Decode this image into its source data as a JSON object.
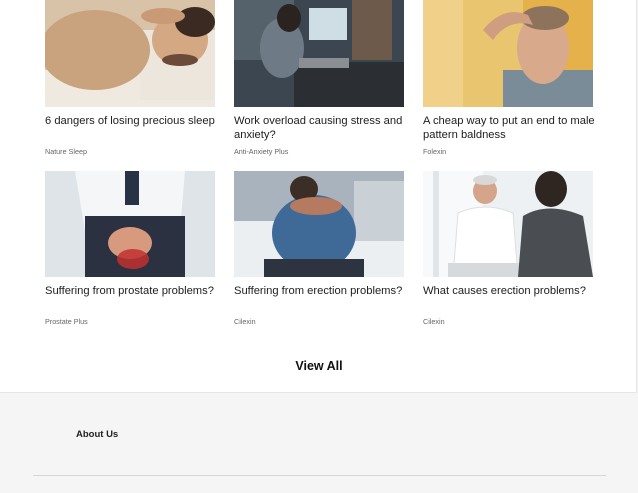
{
  "articles": [
    {
      "title": "6 dangers of losing precious sleep",
      "source": "Nature Sleep"
    },
    {
      "title": "Work overload causing stress and anxiety?",
      "source": "Anti-Anxiety Plus"
    },
    {
      "title": "A cheap way to put an end to male pattern baldness",
      "source": "Folexin"
    },
    {
      "title": "Suffering from prostate problems?",
      "source": "Prostate Plus"
    },
    {
      "title": "Suffering from erection problems?",
      "source": "Cilexin"
    },
    {
      "title": "What causes erection problems?",
      "source": "Cilexin"
    }
  ],
  "view_all_label": "View All",
  "footer": {
    "about_label": "About Us"
  }
}
